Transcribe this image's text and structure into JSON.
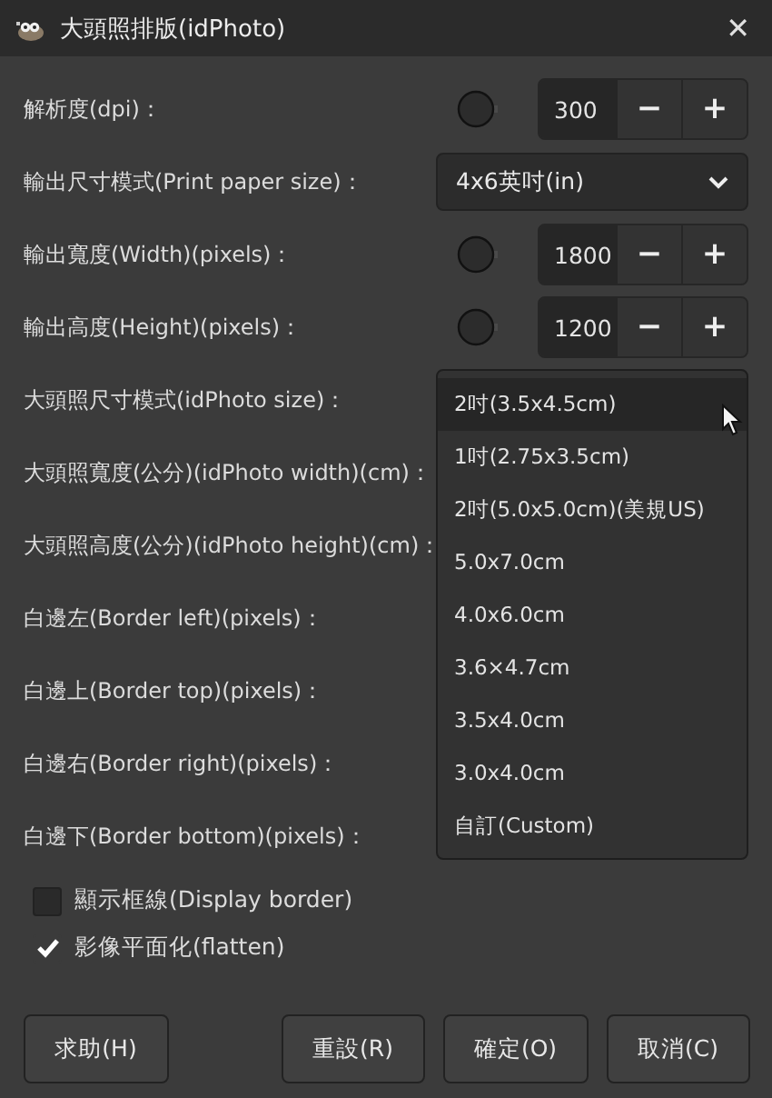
{
  "window": {
    "title": "大頭照排版(idPhoto)",
    "close": "✕"
  },
  "fields": [
    {
      "kind": "spin",
      "label": "解析度(dpi)：",
      "value": "300",
      "minus": "−",
      "plus": "+"
    },
    {
      "kind": "combo",
      "label": "輸出尺寸模式(Print paper size)：",
      "value": "4x6英吋(in)"
    },
    {
      "kind": "spin",
      "label": "輸出寬度(Width)(pixels)：",
      "value": "1800",
      "minus": "−",
      "plus": "+"
    },
    {
      "kind": "spin",
      "label": "輸出高度(Height)(pixels)：",
      "value": "1200",
      "minus": "−",
      "plus": "+"
    },
    {
      "kind": "hidden",
      "label": "大頭照尺寸模式(idPhoto size)："
    },
    {
      "kind": "hidden",
      "label": "大頭照寬度(公分)(idPhoto width)(cm)："
    },
    {
      "kind": "hidden",
      "label": "大頭照高度(公分)(idPhoto height)(cm)："
    },
    {
      "kind": "hidden",
      "label": "白邊左(Border left)(pixels)："
    },
    {
      "kind": "hidden",
      "label": "白邊上(Border top)(pixels)："
    },
    {
      "kind": "hidden",
      "label": "白邊右(Border right)(pixels)："
    },
    {
      "kind": "hidden",
      "label": "白邊下(Border bottom)(pixels)："
    }
  ],
  "popup": {
    "items": [
      {
        "label": "2吋(3.5x4.5cm)",
        "selected": true
      },
      {
        "label": "1吋(2.75x3.5cm)",
        "selected": false
      },
      {
        "label": "2吋(5.0x5.0cm)(美規US)",
        "selected": false
      },
      {
        "label": "5.0x7.0cm",
        "selected": false
      },
      {
        "label": "4.0x6.0cm",
        "selected": false
      },
      {
        "label": "3.6×4.7cm",
        "selected": false
      },
      {
        "label": "3.5x4.0cm",
        "selected": false
      },
      {
        "label": "3.0x4.0cm",
        "selected": false
      },
      {
        "label": "自訂(Custom)",
        "selected": false
      }
    ]
  },
  "options": [
    {
      "label": "顯示框線(Display border)",
      "checked": false
    },
    {
      "label": "影像平面化(flatten)",
      "checked": true
    }
  ],
  "buttons": [
    {
      "label": "求助(H)"
    },
    {
      "label": "重設(R)"
    },
    {
      "label": "確定(O)"
    },
    {
      "label": "取消(C)"
    }
  ]
}
